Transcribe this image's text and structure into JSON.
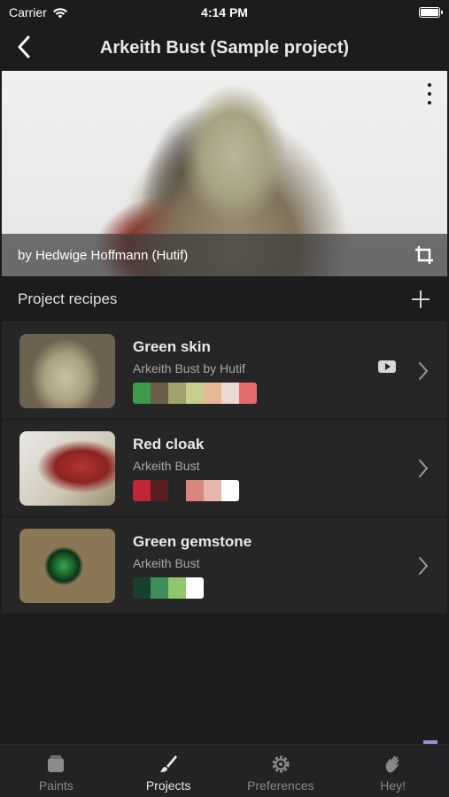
{
  "status_bar": {
    "carrier": "Carrier",
    "time": "4:14 PM"
  },
  "nav": {
    "title": "Arkeith Bust (Sample project)"
  },
  "hero": {
    "caption": "by Hedwige Hoffmann (Hutif)"
  },
  "section": {
    "title": "Project recipes"
  },
  "recipes": [
    {
      "name": "Green skin",
      "subtitle": "Arkeith Bust by Hutif",
      "has_video": true,
      "swatches": [
        "#3f9a49",
        "#6b5e49",
        "#a3a26a",
        "#c8cf8c",
        "#e7b896",
        "#ecdad2",
        "#e56a6e"
      ]
    },
    {
      "name": "Red cloak",
      "subtitle": "Arkeith Bust",
      "swatches": [
        "#c22533",
        "#5a1f21",
        "#262627",
        "#d9877d",
        "#e7b7ad",
        "#ffffff"
      ]
    },
    {
      "name": "Green gemstone",
      "subtitle": "Arkeith Bust",
      "swatches": [
        "#17412d",
        "#3f8f5b",
        "#90c66c",
        "#ffffff"
      ]
    }
  ],
  "tabs": [
    {
      "label": "Paints",
      "icon": "paints-icon"
    },
    {
      "label": "Projects",
      "icon": "brush-icon",
      "active": true
    },
    {
      "label": "Preferences",
      "icon": "gear-icon"
    },
    {
      "label": "Hey!",
      "icon": "wave-hand-icon"
    }
  ],
  "colors": {
    "background": "#1c1c1e",
    "row": "#262627",
    "tab_bar": "#232325",
    "bookmark": "#a48bd4"
  }
}
